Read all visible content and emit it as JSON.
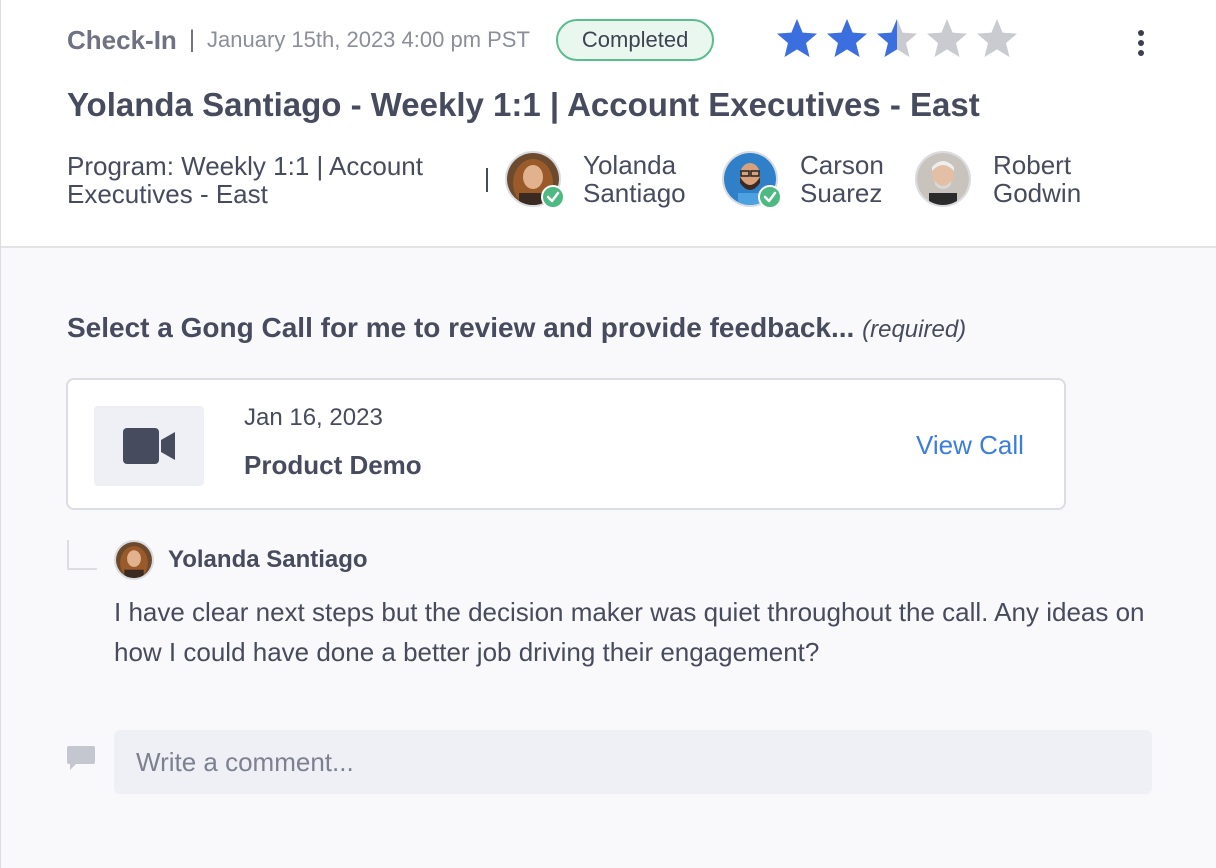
{
  "header": {
    "type_label": "Check-In",
    "separator": "|",
    "date": "January 15th, 2023 4:00 pm PST",
    "status": "Completed",
    "rating": {
      "value": 2.5,
      "max": 5
    },
    "title": "Yolanda Santiago - Weekly 1:1 | Account Executives - East",
    "program": "Program: Weekly 1:1 | Account Executives - East",
    "participants": [
      {
        "name": "Yolanda Santiago",
        "checked_in": true
      },
      {
        "name": "Carson Suarez",
        "checked_in": true
      },
      {
        "name": "Robert Godwin",
        "checked_in": false
      }
    ]
  },
  "question": {
    "text": "Select a Gong Call for me to review and provide feedback...",
    "required_label": "(required)"
  },
  "call": {
    "icon": "video-camera-icon",
    "date": "Jan 16, 2023",
    "name": "Product Demo",
    "link_label": "View Call"
  },
  "comment": {
    "author": "Yolanda Santiago",
    "text": "I have clear next steps but the decision maker was quiet throughout the call. Any ideas on how I could have done a better job driving their engagement?"
  },
  "new_comment": {
    "icon": "comment-icon",
    "placeholder": "Write a comment..."
  },
  "colors": {
    "star_filled": "#3b6fe0",
    "star_empty": "#c9cbd1",
    "status_border": "#5bbd8e",
    "link": "#3b7ddd",
    "check": "#4dba82"
  }
}
